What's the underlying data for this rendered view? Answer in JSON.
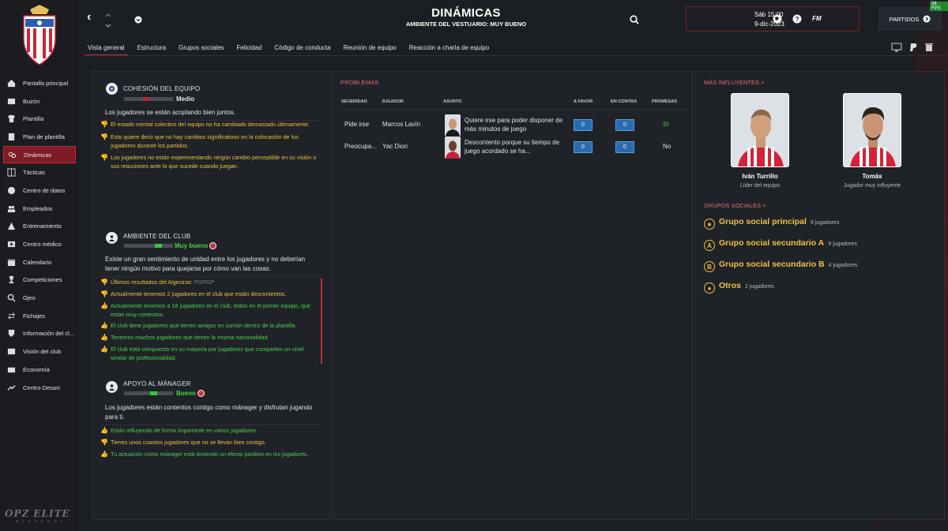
{
  "header": {
    "title": "DINÁMICAS",
    "subtitle": "AMBIENTE DEL VESTUARIO: MUY BUENO",
    "date_line1": "Sáb 15:00",
    "date_line2": "9-dic-2023",
    "fm_label": "FM",
    "partidos_label": "PARTIDOS",
    "fps": "34 FPS"
  },
  "tabs": [
    "Vista general",
    "Estructura",
    "Grupos sociales",
    "Felicidad",
    "Código de conducta",
    "Reunión de equipo",
    "Reacción a charla de equipo"
  ],
  "sidebar": {
    "items": [
      {
        "label": "Pantalla principal",
        "icon": "home-icon"
      },
      {
        "label": "Buzón",
        "icon": "inbox-icon"
      },
      {
        "label": "Plantilla",
        "icon": "squad-icon"
      },
      {
        "label": "Plan de plantilla",
        "icon": "plan-icon"
      },
      {
        "label": "Dinámicas",
        "icon": "dynamics-icon"
      },
      {
        "label": "Tácticas",
        "icon": "tactics-icon"
      },
      {
        "label": "Centro de datos",
        "icon": "data-icon"
      },
      {
        "label": "Empleados",
        "icon": "staff-icon"
      },
      {
        "label": "Entrenamiento",
        "icon": "training-icon"
      },
      {
        "label": "Centro médico",
        "icon": "medical-icon"
      },
      {
        "label": "Calendario",
        "icon": "calendar-icon"
      },
      {
        "label": "Competiciones",
        "icon": "trophy-icon"
      },
      {
        "label": "Ojeo",
        "icon": "scouting-icon"
      },
      {
        "label": "Fichajes",
        "icon": "transfers-icon"
      },
      {
        "label": "Información del cl...",
        "icon": "club-info-icon"
      },
      {
        "label": "Visión del club",
        "icon": "club-vision-icon"
      },
      {
        "label": "Economía",
        "icon": "finances-icon"
      },
      {
        "label": "Centro Desarr.",
        "icon": "development-icon"
      }
    ],
    "active_index": 4,
    "bottom_logo_line1": "OPZ ELITE",
    "bottom_logo_line2": "BLACKOUT"
  },
  "cohesion": {
    "title": "COHESIÓN DEL EQUIPO",
    "rating": "Medio",
    "level": 0.45,
    "summary": "Los jugadores se están acoplando bien juntos.",
    "facts": [
      {
        "text": "El estado mental colectivo del equipo no ha cambiado demasiado últimamente.",
        "tone": "neutral"
      },
      {
        "text": "Esto quiere decir que no hay cambios significativos en la colocación de los jugadores durante los partidos.",
        "tone": "neutral"
      },
      {
        "text": "Los jugadores no están experimentando ningún cambio perceptible en su visión o sus reacciones ante lo que sucede cuando juegan.",
        "tone": "neutral"
      }
    ]
  },
  "atmosphere": {
    "title": "AMBIENTE DEL CLUB",
    "rating": "Muy bueno",
    "level": 0.7,
    "summary": "Existe un gran sentimiento de unidad entre los jugadores y no deberían tener ningún motivo para quejarse por cómo van las cosas.",
    "results_label": "Últimos resultados del Algeciras:",
    "results_form": "PGPGP",
    "facts": [
      {
        "text": "Actualmente tenemos 2 jugadores en el club que están descontentos.",
        "tone": "neutral"
      },
      {
        "text": "Actualmente tenemos a 18 jugadores en el club, todos en el primer equipo, que están muy contentos.",
        "tone": "positive"
      },
      {
        "text": "El club tiene jugadores que tienen amigos en común dentro de la plantilla.",
        "tone": "positive"
      },
      {
        "text": "Tenemos muchos jugadores que tienen la misma nacionalidad.",
        "tone": "positive"
      },
      {
        "text": "El club está compuesto en su mayoría por jugadores que comparten un nivel similar de profesionalidad.",
        "tone": "positive"
      }
    ]
  },
  "manager_support": {
    "title": "APOYO AL MÁNAGER",
    "rating": "Bueno",
    "level": 0.6,
    "summary": "Los jugadores están contentos contigo como mánager y disfrutan jugando para ti.",
    "facts": [
      {
        "text": "Estás influyendo de forma importante en varios jugadores.",
        "tone": "positive"
      },
      {
        "text": "Tienes unos cuantos jugadores que no se llevan bien contigo.",
        "tone": "neutral"
      },
      {
        "text": "Tu actuación como mánager está teniendo un efecto positivo en los jugadores.",
        "tone": "positive"
      }
    ]
  },
  "problems": {
    "title": "PROBLEMAS",
    "columns": [
      "SEVERIDAD",
      "JUGADOR",
      "ASUNTO",
      "A FAVOR",
      "EN CONTRA",
      "PROMESAS"
    ],
    "rows": [
      {
        "severity": "Pide irse",
        "player": "Marcos Lavín",
        "issue": "Quiere irse para poder disponer de más minutos de juego",
        "for": "0",
        "against": "0",
        "promises": "Sí"
      },
      {
        "severity": "Preocupa...",
        "player": "Yac Diori",
        "issue": "Descontento porque su tiempo de juego acordado se ha...",
        "for": "0",
        "against": "0",
        "promises": "No"
      }
    ]
  },
  "influential": {
    "title": "MÁS INFLUYENTES >",
    "players": [
      {
        "name": "Iván Turrillo",
        "role": "Líder del equipo"
      },
      {
        "name": "Tomás",
        "role": "Jugador muy influyente"
      }
    ]
  },
  "social_groups": {
    "title": "GRUPOS SOCIALES >",
    "groups": [
      {
        "name": "Grupo social principal",
        "count": "9 jugadores",
        "icon": "star-icon",
        "badge": "★"
      },
      {
        "name": "Grupo social secundario A",
        "count": "9 jugadores",
        "icon": "letter-a-icon",
        "badge": "A"
      },
      {
        "name": "Grupo social secundario B",
        "count": "4 jugadores",
        "icon": "letter-b-icon",
        "badge": "B"
      },
      {
        "name": "Otros",
        "count": "2 jugadores",
        "icon": "dot-icon",
        "badge": "●"
      }
    ]
  },
  "colors": {
    "accent": "#c7283a",
    "positive": "#49d24a",
    "neutral": "#f0c040",
    "link": "#e06c75"
  }
}
